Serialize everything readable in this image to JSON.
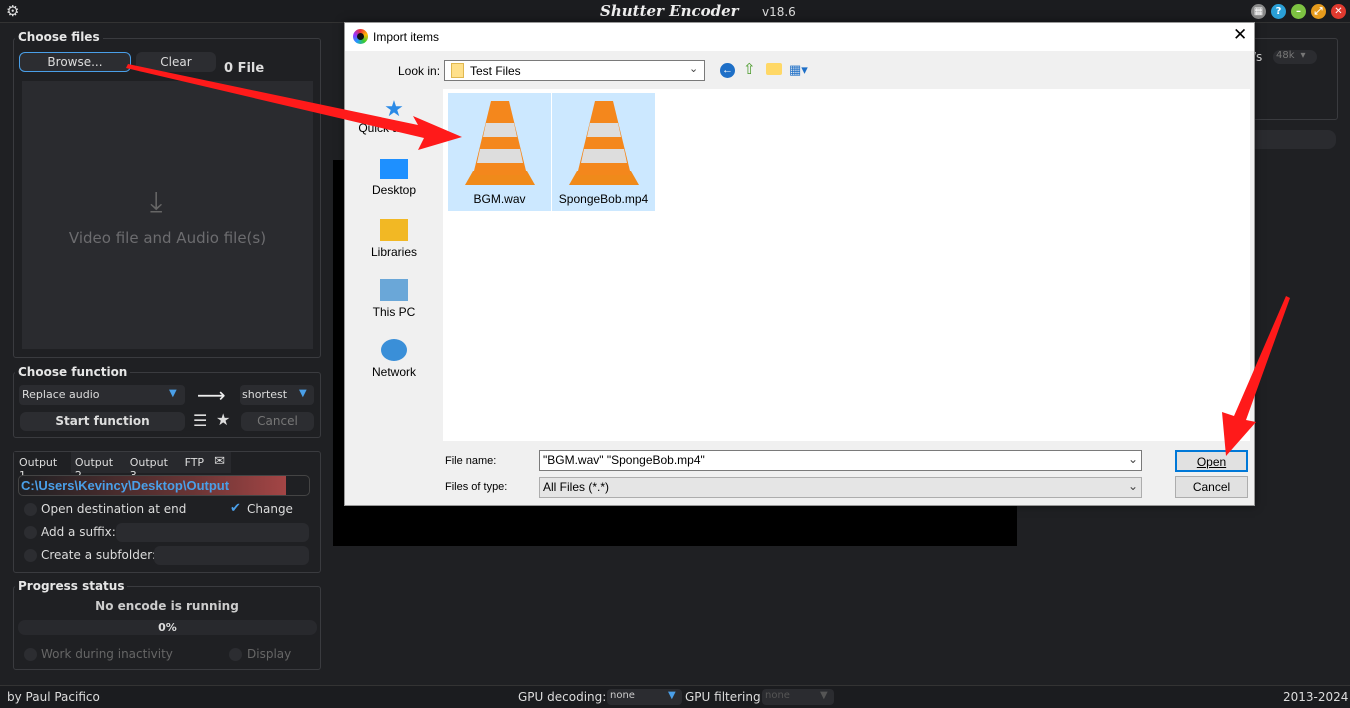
{
  "app": {
    "title": "Shutter Encoder",
    "version": "v18.6"
  },
  "choose_files": {
    "title": "Choose files",
    "browse": "Browse...",
    "clear": "Clear",
    "count": "0 File",
    "drop_hint": "Video file and Audio file(s)"
  },
  "choose_function": {
    "title": "Choose function",
    "function": "Replace audio",
    "mode": "shortest",
    "start": "Start function",
    "cancel": "Cancel"
  },
  "output": {
    "tabs": [
      "Output 1",
      "Output 2",
      "Output 3",
      "FTP"
    ],
    "path": "C:\\Users\\Kevincy\\Desktop\\Output",
    "open_dest": "Open destination at end",
    "change": "Change",
    "change_checked": true,
    "suffix": "Add a suffix:",
    "subfolder": "Create a subfolder:"
  },
  "progress": {
    "title": "Progress status",
    "status": "No encode is running",
    "percent": "0%",
    "work_inactivity": "Work during inactivity",
    "display": "Display"
  },
  "right_panel": {
    "unit": "/s",
    "rate": "48k"
  },
  "footer": {
    "author": "by Paul Pacifico",
    "gpu_decoding_label": "GPU decoding:",
    "gpu_decoding": "none",
    "gpu_filtering_label": "GPU filtering:",
    "gpu_filtering": "none",
    "years": "2013-2024"
  },
  "dialog": {
    "title": "Import items",
    "look_in_label": "Look in:",
    "look_in": "Test Files",
    "places": [
      "Quick access",
      "Desktop",
      "Libraries",
      "This PC",
      "Network"
    ],
    "items": [
      "BGM.wav",
      "SpongeBob.mp4"
    ],
    "file_name_label": "File name:",
    "file_name": "\"BGM.wav\" \"SpongeBob.mp4\"",
    "file_type_label": "Files of type:",
    "file_type": "All Files (*.*)",
    "open": "Open",
    "cancel": "Cancel"
  },
  "colors": {
    "accent": "#4a9fe8",
    "arrow": "#ff1a1a",
    "path_bar": "#a34545"
  }
}
